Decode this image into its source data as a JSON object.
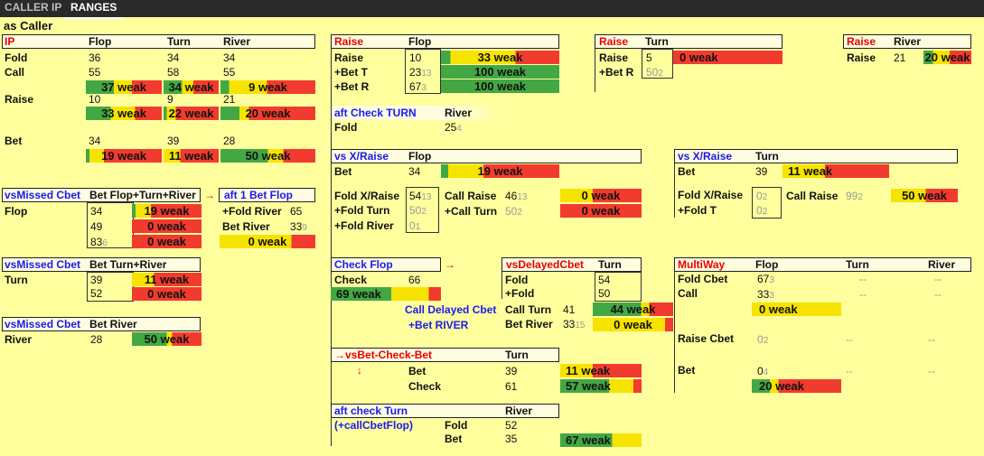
{
  "colors": {
    "green": "#43a843",
    "yellow": "#f7e300",
    "red": "#f23b2f",
    "header_bg": "#fffde0",
    "bg": "#ffff9e"
  },
  "tabs": [
    "CALLER IP",
    "RANGES"
  ],
  "page_title": "as Caller",
  "ip": {
    "title": "IP",
    "cols": [
      "Flop",
      "Turn",
      "River"
    ],
    "rows": [
      {
        "label": "Fold",
        "vals": [
          "36",
          "34",
          "34"
        ]
      },
      {
        "label": "Call",
        "vals": [
          "55",
          "58",
          "55"
        ]
      },
      {
        "label": "Raise",
        "vals": [
          "10",
          "9",
          "21"
        ]
      },
      {
        "label": "Bet",
        "vals": [
          "34",
          "39",
          "28"
        ]
      }
    ],
    "call_bars": [
      {
        "text": "37 weak",
        "g": 0.37,
        "y": 0.24
      },
      {
        "text": "34 weak",
        "g": 0.34,
        "y": 0.2
      },
      {
        "text": "9 weak",
        "g": 0.09,
        "y": 0.4
      }
    ],
    "raise_bars": [
      {
        "text": "33 weak",
        "g": 0.33,
        "y": 0.32
      },
      {
        "text": "22 weak",
        "g": 0.06,
        "y": 0.16
      },
      {
        "text": "20 weak",
        "g": 0.2,
        "y": 0.1
      }
    ],
    "bet_bars": [
      {
        "text": "19 weak",
        "g": 0.05,
        "y": 0.19
      },
      {
        "text": "11 weak",
        "g": 0.0,
        "y": 0.3
      },
      {
        "text": "50 weak",
        "g": 0.5,
        "y": 0.16
      }
    ]
  },
  "vs_missed_cbet_1": {
    "title": "vsMissed Cbet",
    "header": "Bet Flop+Turn+River",
    "row_label": "Flop",
    "vals": [
      "34",
      "49",
      "83"
    ],
    "val3_sub": "6",
    "bars": [
      {
        "text": "19 weak",
        "g": 0.05,
        "y": 0.22
      },
      {
        "text": "0 weak",
        "g": 0,
        "y": 0
      },
      {
        "text": "0 weak",
        "g": 0,
        "y": 0
      }
    ],
    "arrow": "→"
  },
  "aft1bet": {
    "title": "aft 1 Bet Flop",
    "fold_river_label": "+Fold River",
    "fold_river_val": "65",
    "bet_river_label": "Bet River",
    "bet_river_val": "33",
    "bet_river_sub": "9",
    "bar": {
      "text": "0 weak",
      "g": 0,
      "y": 0.75
    }
  },
  "vs_missed_cbet_2": {
    "title": "vsMissed Cbet",
    "header": "Bet Turn+River",
    "row_label": "Turn",
    "vals": [
      "39",
      "52"
    ],
    "bars": [
      {
        "text": "11 weak",
        "g": 0,
        "y": 0.32
      },
      {
        "text": "0 weak",
        "g": 0,
        "y": 0
      }
    ]
  },
  "vs_missed_cbet_3": {
    "title": "vsMissed Cbet",
    "header": "Bet River",
    "row_label": "River",
    "val": "28",
    "bar": {
      "text": "50 weak",
      "g": 0.5,
      "y": 0.08
    }
  },
  "raise_flop": {
    "title": "Raise",
    "header": "Flop",
    "rows": [
      {
        "label": "Raise",
        "val": "10",
        "sub": "",
        "bar": {
          "text": "33 weak",
          "g": 0.08,
          "y": 0.55
        }
      },
      {
        "label": "+Bet T",
        "val": "23",
        "sub": "13",
        "bar": {
          "text": "100 weak",
          "g": 1.0,
          "y": 0
        }
      },
      {
        "label": "+Bet R",
        "val": "67",
        "sub": "3",
        "bar": {
          "text": "100 weak",
          "g": 1.0,
          "y": 0
        }
      }
    ]
  },
  "raise_turn": {
    "title": "Raise",
    "header": "Turn",
    "rows": [
      {
        "label": "Raise",
        "val": "5"
      },
      {
        "label": "+Bet R",
        "val": "50",
        "sub": "2"
      }
    ],
    "bar": {
      "text": "0 weak",
      "g": 0,
      "y": 0
    }
  },
  "raise_river": {
    "title": "Raise",
    "header": "River",
    "label": "Raise",
    "val": "21",
    "bar": {
      "text": "20 weak",
      "g": 0.2,
      "y": 0.35
    }
  },
  "aft_check_turn": {
    "title": "aft Check TURN",
    "header": "River",
    "label": "Fold",
    "val": "25",
    "sub": "4"
  },
  "vs_xraise_flop": {
    "title": "vs X/Raise",
    "header": "Flop",
    "bet_label": "Bet",
    "bet_val": "34",
    "bet_bar": {
      "text": "19 weak",
      "g": 0.06,
      "y": 0.3
    },
    "fold_labels": [
      "Fold X/Raise",
      "+Fold Turn",
      "+Fold River"
    ],
    "fold_vals": [
      {
        "v": "54",
        "s": "13"
      },
      {
        "v": "50",
        "s": "2"
      },
      {
        "v": "0",
        "s": "1"
      }
    ],
    "call_labels": [
      "Call Raise",
      "+Call Turn"
    ],
    "call_vals": [
      {
        "v": "46",
        "s": "13"
      },
      {
        "v": "50",
        "s": "2"
      }
    ],
    "call_bars": [
      {
        "text": "0 weak",
        "g": 0,
        "y": 0.4
      },
      {
        "text": "0 weak",
        "g": 0,
        "y": 0
      }
    ]
  },
  "vs_xraise_turn": {
    "title": "vs X/Raise",
    "header": "Turn",
    "bet_label": "Bet",
    "bet_val": "39",
    "bet_bar": {
      "text": "11 weak",
      "g": 0,
      "y": 0.4
    },
    "fold_labels": [
      "Fold X/Raise",
      "+Fold T"
    ],
    "fold_vals": [
      {
        "v": "0",
        "s": "2"
      },
      {
        "v": "0",
        "s": "2"
      }
    ],
    "call_label": "Call Raise",
    "call_val": "99",
    "call_sub": "2",
    "call_bar": {
      "text": "50 weak",
      "g": 0,
      "y": 0.52
    }
  },
  "check_flop": {
    "title": "Check Flop",
    "arrow": "→",
    "label": "Check",
    "val": "66",
    "bar": {
      "text": "69 weak",
      "g": 0.55,
      "y": 0.34
    }
  },
  "delayed_cbet": {
    "title": "vsDelayedCbet",
    "header": "Turn",
    "fold_labels": [
      "Fold",
      "+Fold"
    ],
    "fold_vals": [
      "54",
      "50"
    ],
    "left_labels": [
      "Call Delayed Cbet",
      "+Bet RIVER"
    ],
    "call_turn_label": "Call Turn",
    "call_turn_val": "41",
    "bet_river_label": "Bet River",
    "bet_river_val": "33",
    "bet_river_sub": "15",
    "bars": [
      {
        "text": "44 weak",
        "g": 0.6,
        "y": 0.1
      },
      {
        "text": "0 weak",
        "g": 0,
        "y": 0.9
      }
    ]
  },
  "vsbet_check_bet": {
    "title": "→vsBet-Check-Bet",
    "header": "Turn",
    "down_arrow": "↓",
    "rows": [
      {
        "label": "Bet",
        "val": "39",
        "bar": {
          "text": "11 weak",
          "g": 0,
          "y": 0.4
        }
      },
      {
        "label": "Check",
        "val": "61",
        "bar": {
          "text": "57 weak",
          "g": 0.6,
          "y": 0.3
        }
      }
    ]
  },
  "aft_check_turn2": {
    "title": "aft check Turn",
    "subtitle": "(+callCbetFlop)",
    "header": "River",
    "rows": [
      {
        "label": "Fold",
        "val": "52"
      },
      {
        "label": "Bet",
        "val": "35"
      }
    ],
    "bar": {
      "text": "67 weak",
      "g": 0.64,
      "y": 0.36
    }
  },
  "multiway": {
    "title": "MultiWay",
    "cols": [
      "Flop",
      "Turn",
      "River"
    ],
    "rows": [
      {
        "label": "Fold Cbet",
        "val": "67",
        "sub": "3"
      },
      {
        "label": "Call",
        "val": "33",
        "sub": "3"
      },
      {
        "label": "Raise Cbet",
        "val": "0",
        "sub": "2"
      },
      {
        "label": "Bet",
        "val": "0",
        "sub": "4"
      }
    ],
    "dash": "--",
    "call_bar": {
      "text": "0 weak",
      "g": 0,
      "y": 1
    },
    "bet_bar": {
      "text": "20 weak",
      "g": 0.2,
      "y": 0.1
    }
  }
}
